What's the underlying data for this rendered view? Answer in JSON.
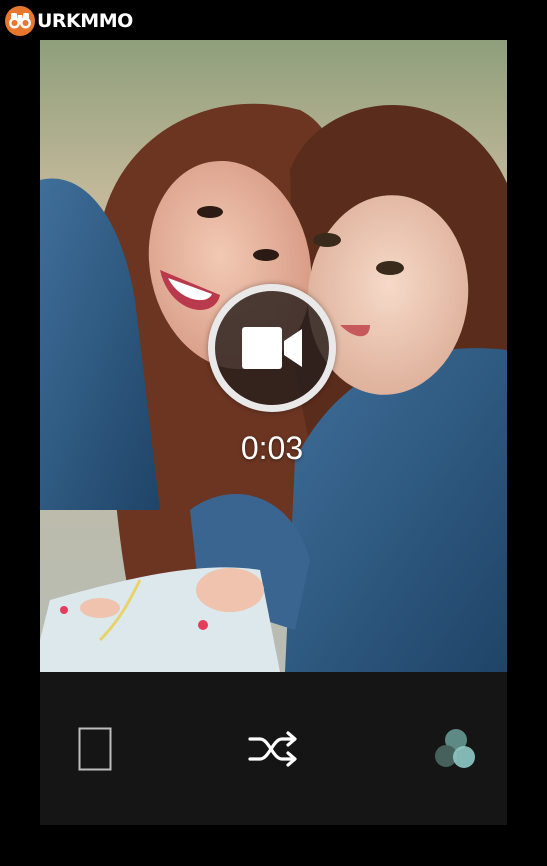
{
  "watermark": {
    "text": "URKMMO",
    "logo_color": "#e8772e"
  },
  "camera": {
    "mode_icon": "video-camera-icon",
    "recording_time": "0:03",
    "preview_content": "photo"
  },
  "controls": {
    "items": [
      {
        "icon": "frame-icon"
      },
      {
        "icon": "shuffle-icon"
      },
      {
        "icon": "filter-icon"
      }
    ]
  },
  "colors": {
    "background": "#000000",
    "control_bar": "#151515",
    "record_ring": "#e9e9e9",
    "filter_light": "#8fc9c4",
    "filter_dark": "#46605c"
  }
}
